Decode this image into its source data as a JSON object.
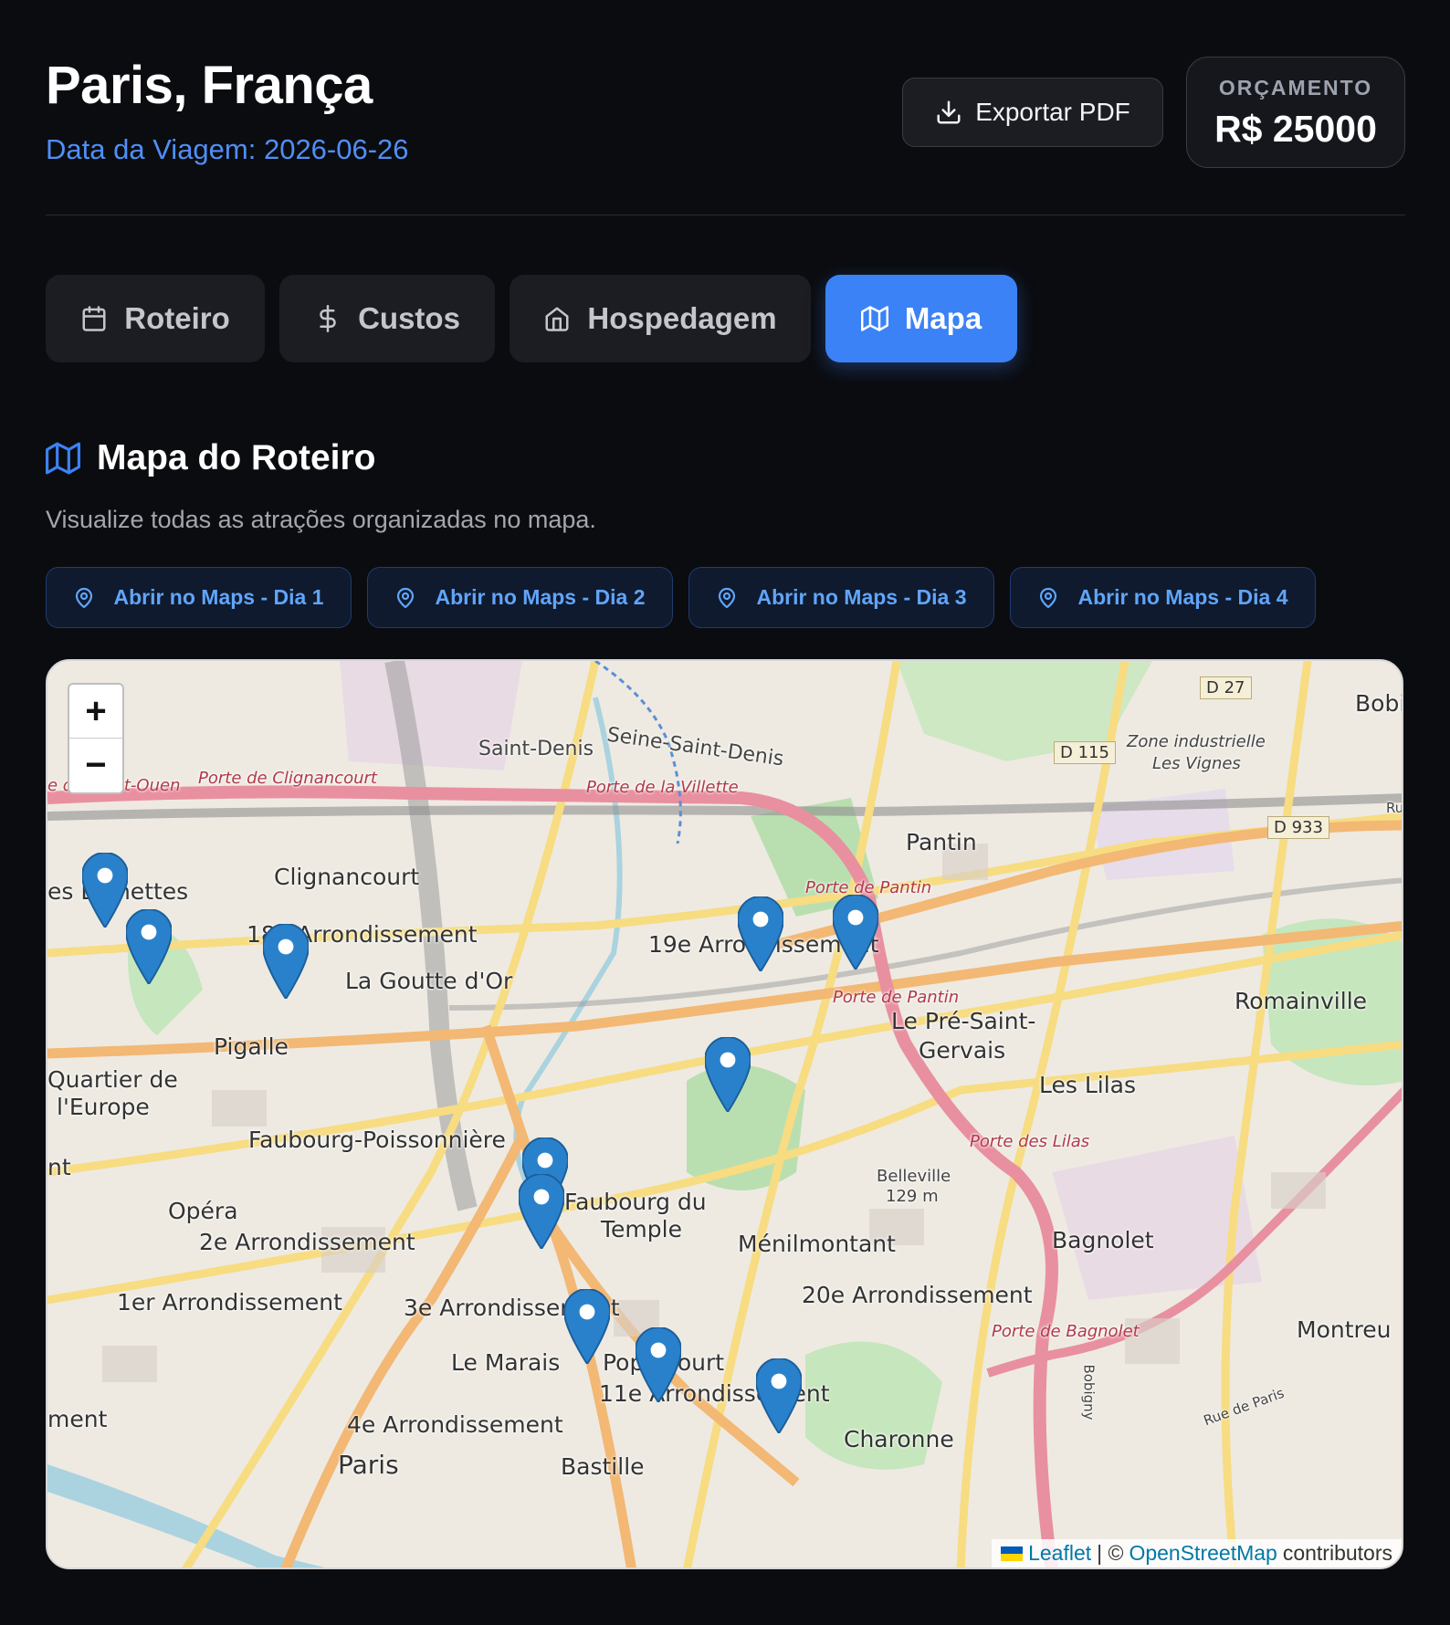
{
  "header": {
    "title": "Paris, França",
    "trip_date": "Data da Viagem: 2026-06-26",
    "export_label": "Exportar PDF",
    "budget_label": "ORÇAMENTO",
    "budget_value": "R$ 25000"
  },
  "tabs": [
    {
      "label": "Roteiro",
      "icon": "calendar-icon",
      "active": false
    },
    {
      "label": "Custos",
      "icon": "dollar-icon",
      "active": false
    },
    {
      "label": "Hospedagem",
      "icon": "home-icon",
      "active": false
    },
    {
      "label": "Mapa",
      "icon": "map-icon",
      "active": true
    }
  ],
  "section": {
    "title": "Mapa do Roteiro",
    "subtitle": "Visualize todas as atrações organizadas no mapa."
  },
  "maps_buttons": [
    {
      "label": "Abrir no Maps - Dia 1"
    },
    {
      "label": "Abrir no Maps - Dia 2"
    },
    {
      "label": "Abrir no Maps - Dia 3"
    },
    {
      "label": "Abrir no Maps - Dia 4"
    }
  ],
  "map": {
    "zoom_in": "+",
    "zoom_out": "−",
    "attribution": {
      "leaflet": "Leaflet",
      "separator": "| ©",
      "osm": "OpenStreetMap",
      "suffix": "contributors"
    },
    "labels": {
      "saint_denis": "Saint-Denis",
      "seine_saint_denis": "Seine-Saint-Denis",
      "porte_saint_ouen": "e de Saint-Ouen",
      "porte_clignancourt": "Porte de Clignancourt",
      "porte_villette": "Porte de la Villette",
      "zone_industrielle": "Zone industrielle",
      "les_vignes": "Les Vignes",
      "d27": "D 27",
      "d115": "D 115",
      "d933": "D 933",
      "bobi": "Bobi",
      "ru": "Ru",
      "pantin": "Pantin",
      "porte_pantin": "Porte de Pantin",
      "porte_pantin2": "Porte de Pantin",
      "clignancourt": "Clignancourt",
      "epinettes": "es Épinettes",
      "arr18": "18e Arrondissement",
      "goutte_dor": "La Goutte d'Or",
      "arr19": "19e Arrondissement",
      "romainville": "Romainville",
      "pre_saint": "Le Pré-Saint-",
      "gervais": "Gervais",
      "pigalle": "Pigalle",
      "quartier_de": "Quartier de",
      "leurope": "l'Europe",
      "les_lilas": "Les Lilas",
      "faubourg_poissonniere": "Faubourg-Poissonnière",
      "porte_lilas": "Porte des Lilas",
      "nt": "nt",
      "belleville": "Belleville",
      "belleville_alt": "129 m",
      "opera": "Opéra",
      "faubourg_du": "Faubourg du",
      "temple": "Temple",
      "arr2": "2e Arrondissement",
      "menilmontant": "Ménilmontant",
      "bagnolet": "Bagnolet",
      "arr1": "1er Arrondissement",
      "arr3": "3e Arrondissement",
      "arr20": "20e Arrondissement",
      "porte_bagnolet": "Porte de Bagnolet",
      "montreu": "Montreu",
      "le_marais": "Le Marais",
      "popincourt": "Popincourt",
      "arr11": "11e Arrondissement",
      "ment": "ment",
      "arr4": "4e Arrondissement",
      "charonne": "Charonne",
      "paris": "Paris",
      "bastille": "Bastille",
      "rue_de_paris": "Rue de Paris",
      "bobigny": "Bobigny"
    }
  }
}
